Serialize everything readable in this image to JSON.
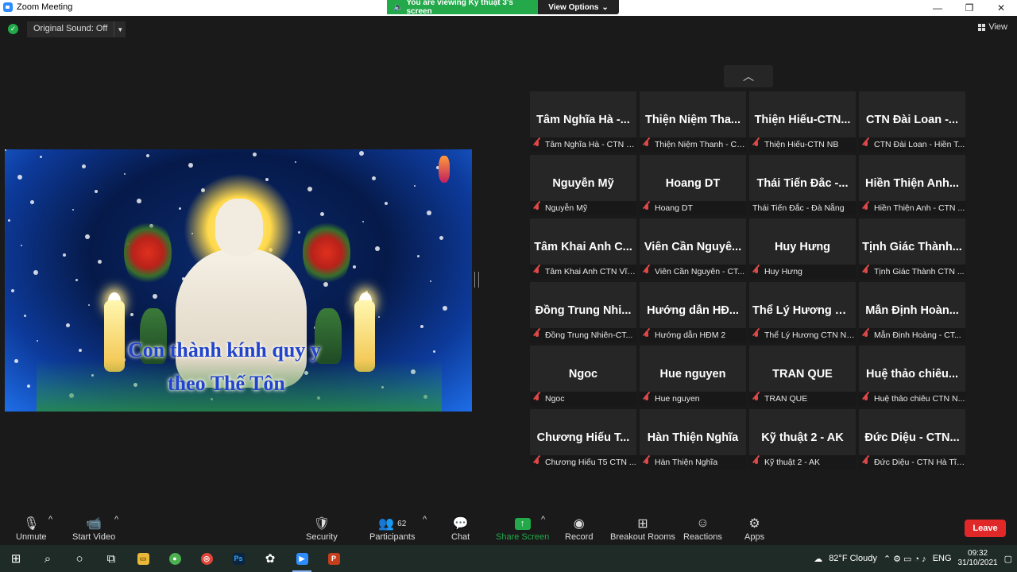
{
  "window": {
    "title": "Zoom Meeting",
    "controls": [
      "minimize",
      "maximize",
      "close"
    ]
  },
  "banner": {
    "viewing": "You are viewing Kỹ thuật 3's screen",
    "view_options": "View Options"
  },
  "top": {
    "original_sound": "Original Sound: Off",
    "view_label": "View"
  },
  "shared_screen": {
    "lyric_line1": "Con thành kính quy y",
    "lyric_line2": "theo Thế Tôn"
  },
  "participants": [
    {
      "big": "Tâm Nghĩa Hà -...",
      "small": "Tâm Nghĩa Hà - CTN Đ...",
      "muted": true
    },
    {
      "big": "Thiện Niệm Tha...",
      "small": "Thiện Niệm Thanh - CT...",
      "muted": true
    },
    {
      "big": "Thiện Hiếu-CTN...",
      "small": "Thiện Hiếu-CTN NB",
      "muted": true
    },
    {
      "big": "CTN Đài Loan -...",
      "small": "CTN Đài Loan - Hiền T...",
      "muted": true
    },
    {
      "big": "Nguyễn Mỹ",
      "small": "Nguyễn Mỹ",
      "muted": true
    },
    {
      "big": "Hoang DT",
      "small": "Hoang DT",
      "muted": true
    },
    {
      "big": "Thái Tiến Đắc -...",
      "small": "Thái Tiến Đắc - Đà Nẵng",
      "muted": false
    },
    {
      "big": "Hiền Thiện Anh...",
      "small": "Hiền Thiện Anh - CTN ...",
      "muted": true
    },
    {
      "big": "Tâm Khai Anh C...",
      "small": "Tâm Khai Anh CTN Vĩn...",
      "muted": true
    },
    {
      "big": "Viên Cần Nguyê...",
      "small": "Viên Cần Nguyên - CT...",
      "muted": true
    },
    {
      "big": "Huy Hưng",
      "small": "Huy Hưng",
      "muted": true
    },
    {
      "big": "Tịnh Giác Thành...",
      "small": "Tịnh Giác Thành CTN ...",
      "muted": true
    },
    {
      "big": "Đồng Trung Nhi...",
      "small": "Đồng Trung Nhiên-CT...",
      "muted": true
    },
    {
      "big": "Hướng dẫn HĐ...",
      "small": "Hướng dẫn HĐM 2",
      "muted": true
    },
    {
      "big": "Thể Lý Hương C...",
      "small": "Thể Lý Hương CTN Nh...",
      "muted": true
    },
    {
      "big": "Mẫn Định Hoàn...",
      "small": "Mẫn Định Hoàng - CT...",
      "muted": true
    },
    {
      "big": "Ngoc",
      "small": "Ngoc",
      "muted": true
    },
    {
      "big": "Hue nguyen",
      "small": "Hue nguyen",
      "muted": true
    },
    {
      "big": "TRAN QUE",
      "small": "TRAN QUE",
      "muted": true
    },
    {
      "big": "Huệ thảo chiêu...",
      "small": "Huệ thảo chiêu CTN N...",
      "muted": true
    },
    {
      "big": "Chương Hiếu T...",
      "small": "Chương Hiếu T5 CTN ...",
      "muted": true
    },
    {
      "big": "Hàn Thiện Nghĩa",
      "small": "Hàn Thiện Nghĩa",
      "muted": true
    },
    {
      "big": "Kỹ thuật 2 - AK",
      "small": "Kỹ thuật 2 - AK",
      "muted": true
    },
    {
      "big": "Đức Diệu - CTN...",
      "small": "Đức Diệu - CTN Hà Tĩnh",
      "muted": true
    }
  ],
  "toolbar": {
    "unmute": "Unmute",
    "start_video": "Start Video",
    "security": "Security",
    "participants": "Participants",
    "participants_count": "62",
    "chat": "Chat",
    "share_screen": "Share Screen",
    "record": "Record",
    "breakout_rooms": "Breakout Rooms",
    "reactions": "Reactions",
    "apps": "Apps",
    "leave": "Leave"
  },
  "taskbar": {
    "weather": "82°F Cloudy",
    "language": "ENG",
    "time": "09:32",
    "date": "31/10/2021",
    "ps_label": "Ps"
  },
  "colors": {
    "accent_green": "#23a84a",
    "leave_red": "#e02828",
    "zoom_blue": "#2d8cff"
  }
}
